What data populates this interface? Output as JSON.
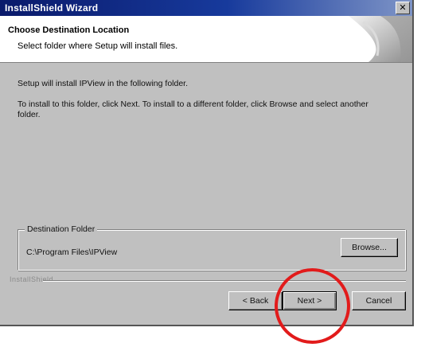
{
  "window": {
    "title": "InstallShield Wizard",
    "close_glyph": "✕"
  },
  "header": {
    "title": "Choose Destination Location",
    "subtitle": "Select folder where Setup will install files."
  },
  "content": {
    "line1": "Setup will install IPView in the following folder.",
    "line2": "To install to this folder, click Next. To install to a different folder, click Browse and select another folder."
  },
  "destination": {
    "legend": "Destination Folder",
    "path": "C:\\Program Files\\IPView",
    "browse_label": "Browse..."
  },
  "footer": {
    "brand": "InstallShield",
    "back_label": "< Back",
    "next_label": "Next >",
    "cancel_label": "Cancel"
  },
  "colors": {
    "titlebar_start": "#0a1a6b",
    "dialog_face": "#c0c0c0",
    "annotation_circle": "#e21b1b"
  }
}
